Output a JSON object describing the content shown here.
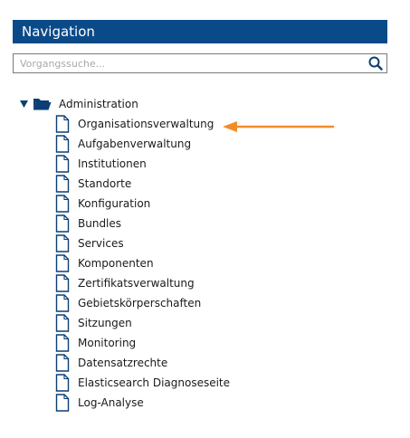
{
  "navigation": {
    "title": "Navigation"
  },
  "search": {
    "placeholder": "Vorgangssuche...",
    "value": "",
    "icon": "search-icon"
  },
  "tree": {
    "root": {
      "label": "Administration",
      "expanded": true,
      "icon": "folder-open-icon"
    },
    "items": [
      {
        "label": "Organisationsverwaltung",
        "icon": "document-icon"
      },
      {
        "label": "Aufgabenverwaltung",
        "icon": "document-icon"
      },
      {
        "label": "Institutionen",
        "icon": "document-icon"
      },
      {
        "label": "Standorte",
        "icon": "document-icon"
      },
      {
        "label": "Konfiguration",
        "icon": "document-icon"
      },
      {
        "label": "Bundles",
        "icon": "document-icon"
      },
      {
        "label": "Services",
        "icon": "document-icon"
      },
      {
        "label": "Komponenten",
        "icon": "document-icon"
      },
      {
        "label": "Zertifikatsverwaltung",
        "icon": "document-icon"
      },
      {
        "label": "Gebietskörperschaften",
        "icon": "document-icon"
      },
      {
        "label": "Sitzungen",
        "icon": "document-icon"
      },
      {
        "label": "Monitoring",
        "icon": "document-icon"
      },
      {
        "label": "Datensatzrechte",
        "icon": "document-icon"
      },
      {
        "label": "Elasticsearch Diagnoseseite",
        "icon": "document-icon"
      },
      {
        "label": "Log-Analyse",
        "icon": "document-icon"
      }
    ]
  },
  "annotation": {
    "icon": "arrow-left-icon",
    "points_to": "Organisationsverwaltung"
  },
  "colors": {
    "header_bg": "#0b4a88",
    "header_text": "#ffffff",
    "tree_icon": "#0b3f73",
    "arrow": "#f28c28",
    "search_border": "#7a7a7a",
    "placeholder": "#a8a8a8"
  }
}
